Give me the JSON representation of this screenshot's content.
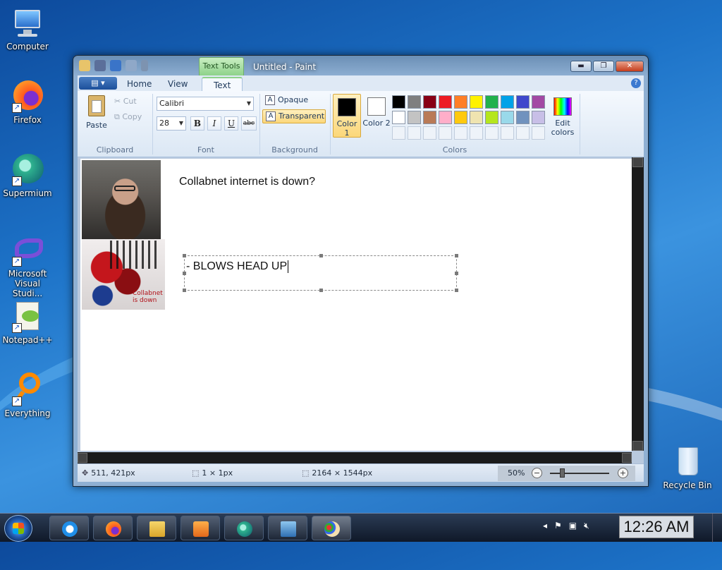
{
  "desktop": {
    "icons": [
      {
        "label": "Computer"
      },
      {
        "label": "Firefox"
      },
      {
        "label": "Supermium"
      },
      {
        "label": "Microsoft Visual Studi..."
      },
      {
        "label": "Notepad++"
      },
      {
        "label": "Everything"
      },
      {
        "label": "Recycle Bin"
      }
    ]
  },
  "window": {
    "title": "Untitled - Paint",
    "context_tab": "Text Tools",
    "buttons": {
      "minimize": "▬",
      "maximize": "❐",
      "close": "✕"
    },
    "help": "?"
  },
  "ribbon": {
    "tabs": [
      "Home",
      "View",
      "Text"
    ],
    "active_tab": "Text",
    "clipboard": {
      "paste": "Paste",
      "cut": "Cut",
      "copy": "Copy",
      "group": "Clipboard"
    },
    "font": {
      "family": "Calibri",
      "size": "28",
      "bold": "B",
      "italic": "I",
      "underline": "U",
      "strike": "abc",
      "group": "Font"
    },
    "background": {
      "opaque": "Opaque",
      "transparent": "Transparent",
      "group": "Background"
    },
    "colors": {
      "color1": "Color 1",
      "color2": "Color 2",
      "edit": "Edit colors",
      "group": "Colors",
      "color1_value": "#000000",
      "color2_value": "#ffffff",
      "palette": [
        "#000000",
        "#7f7f7f",
        "#880015",
        "#ed1c24",
        "#ff7f27",
        "#fff200",
        "#22b14c",
        "#00a2e8",
        "#3f48cc",
        "#a349a4",
        "#ffffff",
        "#c3c3c3",
        "#b97a57",
        "#ffaec9",
        "#ffc90e",
        "#efe4b0",
        "#b5e61d",
        "#99d9ea",
        "#7092be",
        "#c8bfe7"
      ]
    }
  },
  "canvas": {
    "text1": "Collabnet internet is down?",
    "textbox": "- BLOWS HEAD UP",
    "meme_small_text": "Collabnet is down"
  },
  "status": {
    "cursor": "511, 421px",
    "selection": "1 × 1px",
    "image_size": "2164 × 1544px",
    "zoom": "50%"
  },
  "taskbar": {
    "clock": "12:26 AM"
  }
}
